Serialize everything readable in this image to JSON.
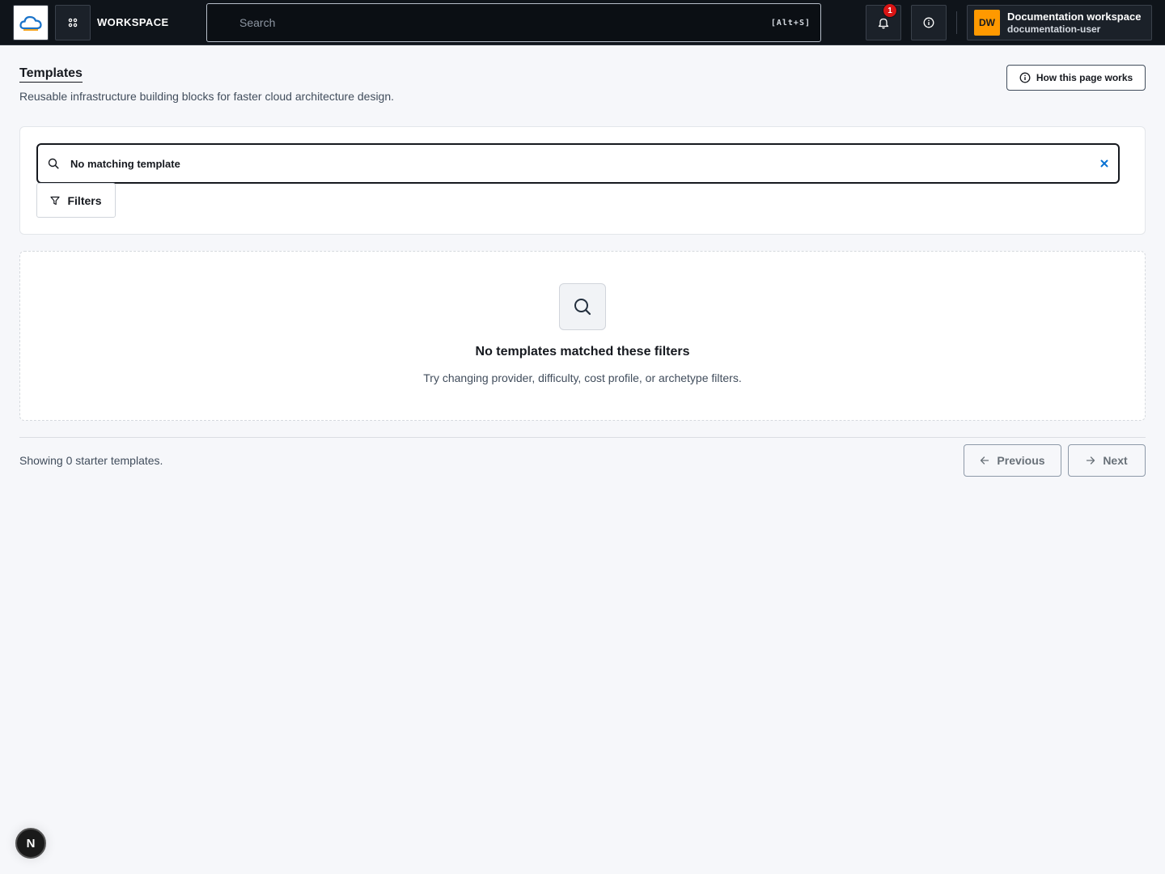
{
  "topbar": {
    "workspace_label": "WORKSPACE",
    "search_placeholder": "Search",
    "search_shortcut": "[Alt+S]",
    "notification_count": "1",
    "user": {
      "initials": "DW",
      "name": "Documentation workspace",
      "handle": "documentation-user"
    }
  },
  "header": {
    "title": "Templates",
    "subtitle": "Reusable infrastructure building blocks for faster cloud architecture design.",
    "help_button_label": "How this page works"
  },
  "filters": {
    "search_value": "No matching template",
    "filters_button_label": "Filters"
  },
  "empty_state": {
    "title": "No templates matched these filters",
    "description": "Try changing provider, difficulty, cost profile, or archetype filters."
  },
  "footer": {
    "showing_text": "Showing 0 starter templates.",
    "previous_label": "Previous",
    "next_label": "Next"
  },
  "dev_badge": {
    "label": "N"
  },
  "colors": {
    "topbar_bg": "#0f141a",
    "avatar_bg": "#ff9900",
    "badge_red": "#d91515",
    "clear_icon": "#0972d3"
  }
}
